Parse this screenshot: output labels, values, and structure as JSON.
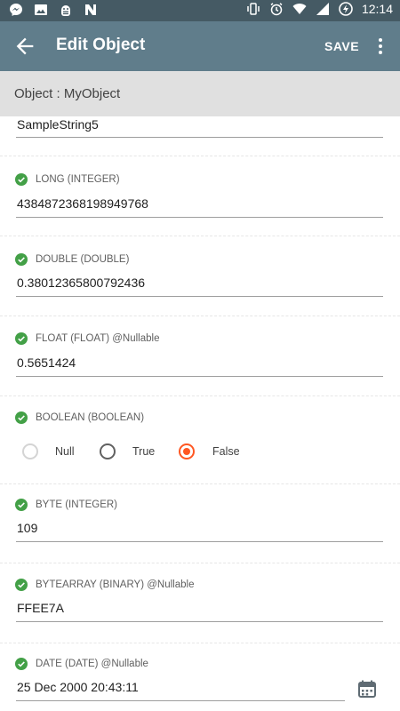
{
  "status_bar": {
    "time": "12:14"
  },
  "app_bar": {
    "title": "Edit Object",
    "save_label": "SAVE"
  },
  "subheader": {
    "text": "Object : MyObject"
  },
  "fields": [
    {
      "value": "SampleString5"
    },
    {
      "label": "LONG (INTEGER)",
      "value": "4384872368198949768"
    },
    {
      "label": "DOUBLE (DOUBLE)",
      "value": "0.38012365800792436"
    },
    {
      "label": "FLOAT (FLOAT) @Nullable",
      "value": "0.5651424"
    },
    {
      "label": "BOOLEAN (BOOLEAN)",
      "options": [
        "Null",
        "True",
        "False"
      ],
      "selected": "False"
    },
    {
      "label": "BYTE (INTEGER)",
      "value": "109"
    },
    {
      "label": "BYTEARRAY (BINARY) @Nullable",
      "value": "FFEE7A"
    },
    {
      "label": "DATE (DATE) @Nullable",
      "value": "25 Dec 2000 20:43:11"
    }
  ],
  "colors": {
    "status_bar": "#455a64",
    "app_bar": "#607d8b",
    "subheader": "#e0e0e0",
    "check": "#43a047",
    "radio_selected": "#ff5722"
  }
}
